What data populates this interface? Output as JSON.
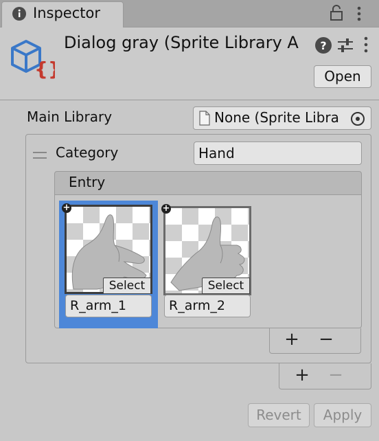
{
  "tab": {
    "title": "Inspector"
  },
  "header": {
    "title": "Dialog gray (Sprite Library A",
    "open_label": "Open"
  },
  "main_library": {
    "label": "Main Library",
    "value": "None (Sprite Libra"
  },
  "category": {
    "label": "Category",
    "value": "Hand"
  },
  "entry": {
    "header": "Entry",
    "items": [
      {
        "name": "R_arm_1",
        "select_label": "Select",
        "selected": true
      },
      {
        "name": "R_arm_2",
        "select_label": "Select",
        "selected": false
      }
    ]
  },
  "list_controls": {
    "add": "+",
    "remove": "−"
  },
  "category_controls": {
    "add": "+",
    "remove": "−"
  },
  "footer": {
    "revert_label": "Revert",
    "apply_label": "Apply"
  },
  "colors": {
    "selection": "#4d87d8",
    "panel": "#c8c8c8",
    "field": "#e4e4e4"
  }
}
